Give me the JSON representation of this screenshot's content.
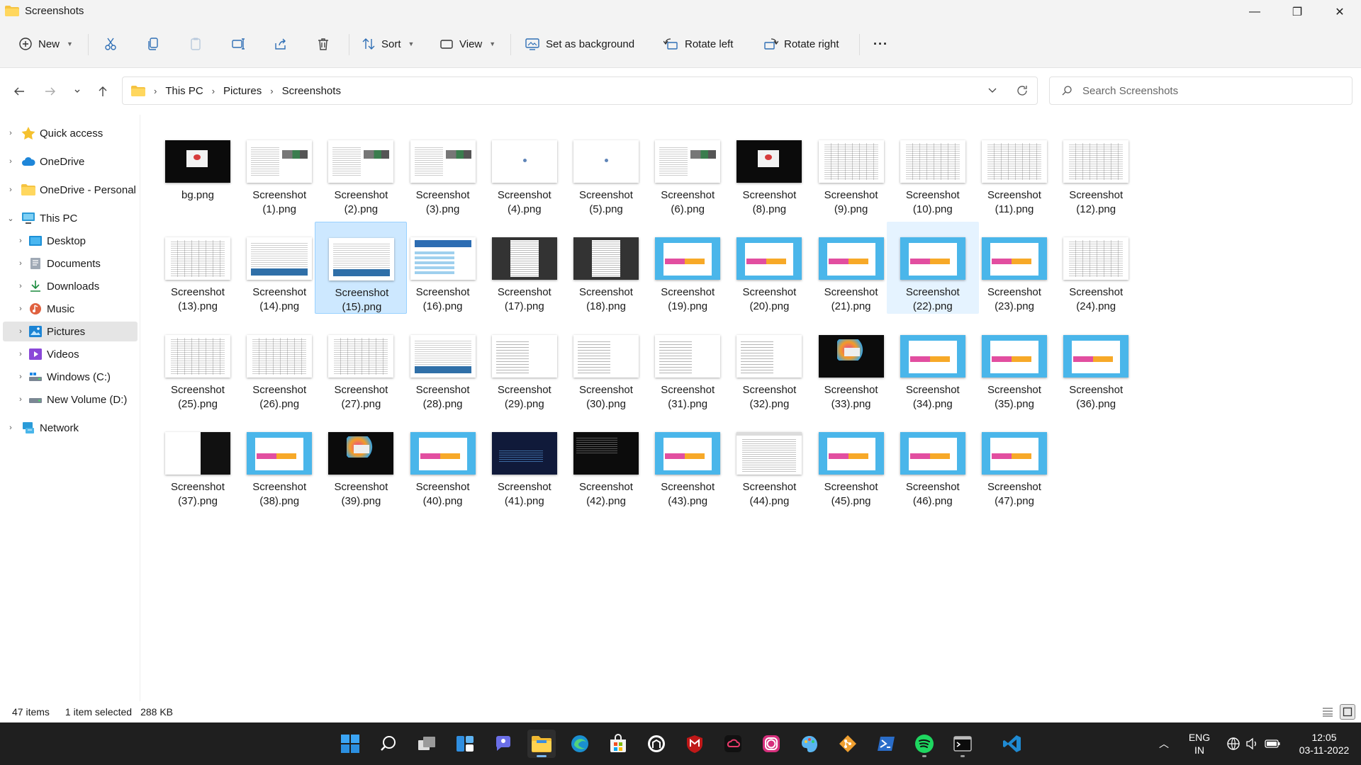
{
  "window": {
    "title": "Screenshots",
    "controls": {
      "minimize": "—",
      "restore": "❐",
      "close": "✕"
    }
  },
  "toolbar": {
    "new_label": "New",
    "sort_label": "Sort",
    "view_label": "View",
    "set_background_label": "Set as background",
    "rotate_left_label": "Rotate left",
    "rotate_right_label": "Rotate right",
    "more_label": "···"
  },
  "address": {
    "crumbs": [
      "This PC",
      "Pictures",
      "Screenshots"
    ],
    "search_placeholder": "Search Screenshots"
  },
  "sidebar": {
    "items": [
      {
        "label": "Quick access",
        "icon": "star-icon"
      },
      {
        "label": "OneDrive",
        "icon": "cloud-icon"
      },
      {
        "label": "OneDrive - Personal",
        "icon": "folder-icon"
      },
      {
        "label": "This PC",
        "icon": "pc-icon"
      },
      {
        "label": "Desktop",
        "icon": "desktop-icon"
      },
      {
        "label": "Documents",
        "icon": "documents-icon"
      },
      {
        "label": "Downloads",
        "icon": "download-icon"
      },
      {
        "label": "Music",
        "icon": "music-icon"
      },
      {
        "label": "Pictures",
        "icon": "pictures-icon"
      },
      {
        "label": "Videos",
        "icon": "videos-icon"
      },
      {
        "label": "Windows (C:)",
        "icon": "drive-icon"
      },
      {
        "label": "New Volume (D:)",
        "icon": "drive-icon"
      },
      {
        "label": "Network",
        "icon": "network-icon"
      }
    ]
  },
  "files": [
    {
      "name": "bg.png",
      "kind": "dark"
    },
    {
      "name": "Screenshot\n(1).png",
      "kind": "screenshot"
    },
    {
      "name": "Screenshot\n(2).png",
      "kind": "screenshot"
    },
    {
      "name": "Screenshot\n(3).png",
      "kind": "screenshot"
    },
    {
      "name": "Screenshot\n(4).png",
      "kind": "blank"
    },
    {
      "name": "Screenshot\n(5).png",
      "kind": "blank"
    },
    {
      "name": "Screenshot\n(6).png",
      "kind": "screenshot"
    },
    {
      "name": "Screenshot\n(8).png",
      "kind": "dark"
    },
    {
      "name": "Screenshot\n(9).png",
      "kind": "sheet"
    },
    {
      "name": "Screenshot\n(10).png",
      "kind": "sheet"
    },
    {
      "name": "Screenshot\n(11).png",
      "kind": "sheet"
    },
    {
      "name": "Screenshot\n(12).png",
      "kind": "sheet"
    },
    {
      "name": "Screenshot\n(13).png",
      "kind": "sheet"
    },
    {
      "name": "Screenshot\n(14).png",
      "kind": "sheetbar"
    },
    {
      "name": "Screenshot\n(15).png",
      "kind": "sheetbar"
    },
    {
      "name": "Screenshot\n(16).png",
      "kind": "webblue"
    },
    {
      "name": "Screenshot\n(17).png",
      "kind": "darkdoc"
    },
    {
      "name": "Screenshot\n(18).png",
      "kind": "darkdoc"
    },
    {
      "name": "Screenshot\n(19).png",
      "kind": "blue"
    },
    {
      "name": "Screenshot\n(20).png",
      "kind": "blue"
    },
    {
      "name": "Screenshot\n(21).png",
      "kind": "blue"
    },
    {
      "name": "Screenshot\n(22).png",
      "kind": "blue"
    },
    {
      "name": "Screenshot\n(23).png",
      "kind": "blue"
    },
    {
      "name": "Screenshot\n(24).png",
      "kind": "sheet"
    },
    {
      "name": "Screenshot\n(25).png",
      "kind": "sheet"
    },
    {
      "name": "Screenshot\n(26).png",
      "kind": "sheet"
    },
    {
      "name": "Screenshot\n(27).png",
      "kind": "sheet"
    },
    {
      "name": "Screenshot\n(28).png",
      "kind": "sheetbar"
    },
    {
      "name": "Screenshot\n(29).png",
      "kind": "textlist"
    },
    {
      "name": "Screenshot\n(30).png",
      "kind": "textlist"
    },
    {
      "name": "Screenshot\n(31).png",
      "kind": "textlist"
    },
    {
      "name": "Screenshot\n(32).png",
      "kind": "textlist"
    },
    {
      "name": "Screenshot\n(33).png",
      "kind": "colorful"
    },
    {
      "name": "Screenshot\n(34).png",
      "kind": "blue"
    },
    {
      "name": "Screenshot\n(35).png",
      "kind": "blue"
    },
    {
      "name": "Screenshot\n(36).png",
      "kind": "blue"
    },
    {
      "name": "Screenshot\n(37).png",
      "kind": "split"
    },
    {
      "name": "Screenshot\n(38).png",
      "kind": "blue"
    },
    {
      "name": "Screenshot\n(39).png",
      "kind": "colorful"
    },
    {
      "name": "Screenshot\n(40).png",
      "kind": "blue"
    },
    {
      "name": "Screenshot\n(41).png",
      "kind": "navy"
    },
    {
      "name": "Screenshot\n(42).png",
      "kind": "terminal"
    },
    {
      "name": "Screenshot\n(43).png",
      "kind": "blue"
    },
    {
      "name": "Screenshot\n(44).png",
      "kind": "webdoc"
    },
    {
      "name": "Screenshot\n(45).png",
      "kind": "blue"
    },
    {
      "name": "Screenshot\n(46).png",
      "kind": "blue"
    },
    {
      "name": "Screenshot\n(47).png",
      "kind": "blue"
    }
  ],
  "selected_file": "Screenshot\n(15).png",
  "hovered_file": "Screenshot\n(22).png",
  "status": {
    "item_count": "47 items",
    "selection": "1 item selected",
    "size": "288 KB"
  },
  "taskbar": {
    "apps": [
      "start-icon",
      "search-icon",
      "task-view-icon",
      "widgets-icon",
      "chat-icon",
      "file-explorer-icon",
      "edge-icon",
      "store-icon",
      "github-desktop-icon",
      "mcafee-icon",
      "creative-cloud-icon",
      "instagram-icon",
      "paint-icon",
      "git-icon",
      "powershell-icon",
      "spotify-icon",
      "terminal-icon",
      "vscode-icon"
    ],
    "active_app": "file-explorer-icon",
    "language": "ENG",
    "region": "IN",
    "time": "12:05",
    "date": "03-11-2022"
  },
  "colors": {
    "accent": "#0067c0",
    "selection_bg": "#cde8ff",
    "hover_bg": "#e5f3ff",
    "taskbar_bg": "#1f1f1f"
  }
}
